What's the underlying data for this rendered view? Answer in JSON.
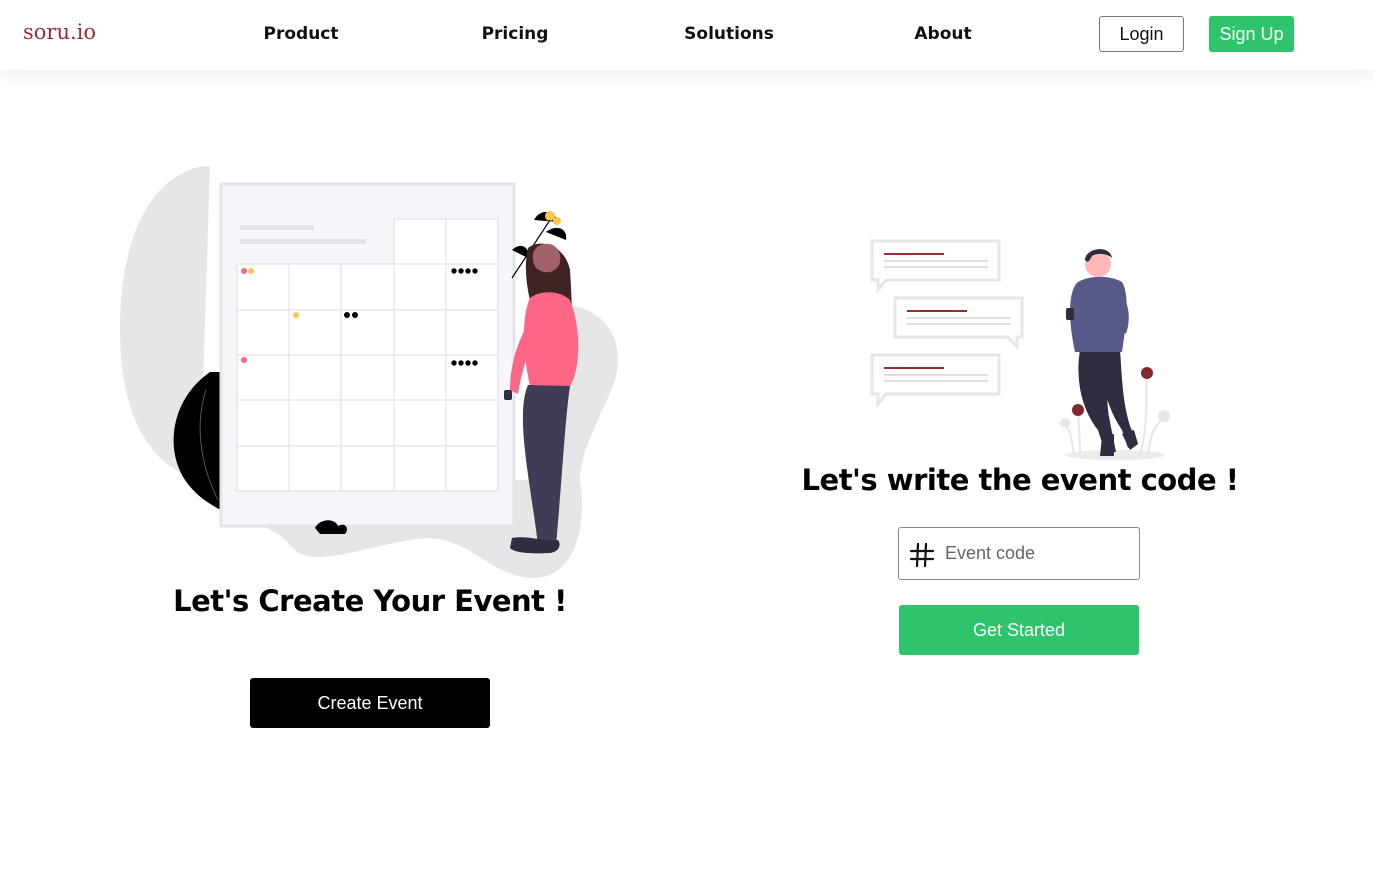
{
  "brand": {
    "logo": "soru.io",
    "accent": "#9b2d30"
  },
  "nav": {
    "links": [
      "Product",
      "Pricing",
      "Solutions",
      "About"
    ]
  },
  "auth": {
    "login": "Login",
    "signup": "Sign Up",
    "signup_color": "#2ec46b"
  },
  "create": {
    "title": "Let's Create Your Event !",
    "button": "Create Event"
  },
  "join": {
    "title": "Let's write the event code !",
    "placeholder": "Event code",
    "field_icon": "hash-icon",
    "button": "Get Started",
    "button_color": "#2ec46b"
  },
  "illustrations": {
    "left": "calendar-woman-illustration",
    "right": "chat-man-illustration"
  }
}
